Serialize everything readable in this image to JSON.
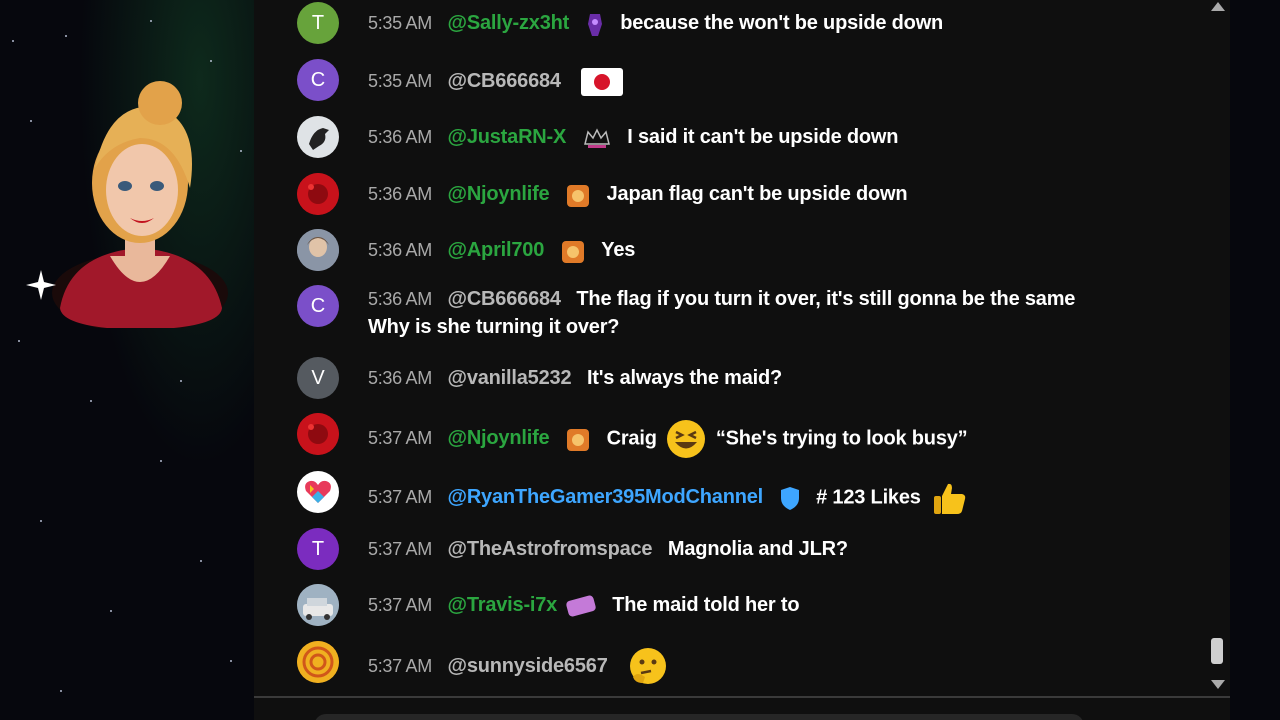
{
  "chat": {
    "messages": [
      {
        "time": "5:35 AM",
        "user": "@Sally-zx3ht",
        "text": "because the won't be upside down",
        "initial": "T",
        "avatar_color": "#67a33b"
      },
      {
        "time": "5:35 AM",
        "user": "@CB666684",
        "text": "",
        "initial": "C",
        "avatar_color": "#7b4fc9"
      },
      {
        "time": "5:36 AM",
        "user": "@JustaRN-X",
        "text": "I said it can't be upside down",
        "initial": "",
        "avatar_color": "#9aa2a6"
      },
      {
        "time": "5:36 AM",
        "user": "@Njoynlife",
        "text": "Japan flag can't be upside down",
        "initial": "",
        "avatar_color": "#c8121b"
      },
      {
        "time": "5:36 AM",
        "user": "@April700",
        "text": "Yes",
        "initial": "",
        "avatar_color": "#7d8aa0"
      },
      {
        "time": "5:36 AM",
        "user": "@CB666684",
        "text": "The flag if you turn it over, it's still gonna be the same",
        "text2": "Why is she turning it over?",
        "initial": "C",
        "avatar_color": "#7b4fc9"
      },
      {
        "time": "5:36 AM",
        "user": "@vanilla5232",
        "text": "It's always the maid?",
        "initial": "V",
        "avatar_color": "#555a60"
      },
      {
        "time": "5:37 AM",
        "user": "@Njoynlife",
        "text": "Craig",
        "text_after": "“She's trying to look busy”",
        "initial": "",
        "avatar_color": "#c8121b"
      },
      {
        "time": "5:37 AM",
        "user": "@RyanTheGamer395ModChannel",
        "text": "# 123 Likes",
        "initial": "",
        "avatar_color": "#ffffff"
      },
      {
        "time": "5:37 AM",
        "user": "@TheAstrofromspace",
        "text": "Magnolia and JLR?",
        "initial": "T",
        "avatar_color": "#7b2cbf"
      },
      {
        "time": "5:37 AM",
        "user": "@Travis-i7x",
        "text": "The maid told her to",
        "initial": "",
        "avatar_color": "#6f7f8e"
      },
      {
        "time": "5:37 AM",
        "user": "@sunnyside6567",
        "text": "",
        "initial": "",
        "avatar_color": "#e8a21a"
      }
    ]
  },
  "icons": {
    "flag": "japan-flag-icon",
    "laugh": "grinning-squinting-face-icon",
    "thumbs": "thumbs-up-icon",
    "thinking": "thinking-face-icon",
    "shield": "moderator-shield-icon"
  }
}
